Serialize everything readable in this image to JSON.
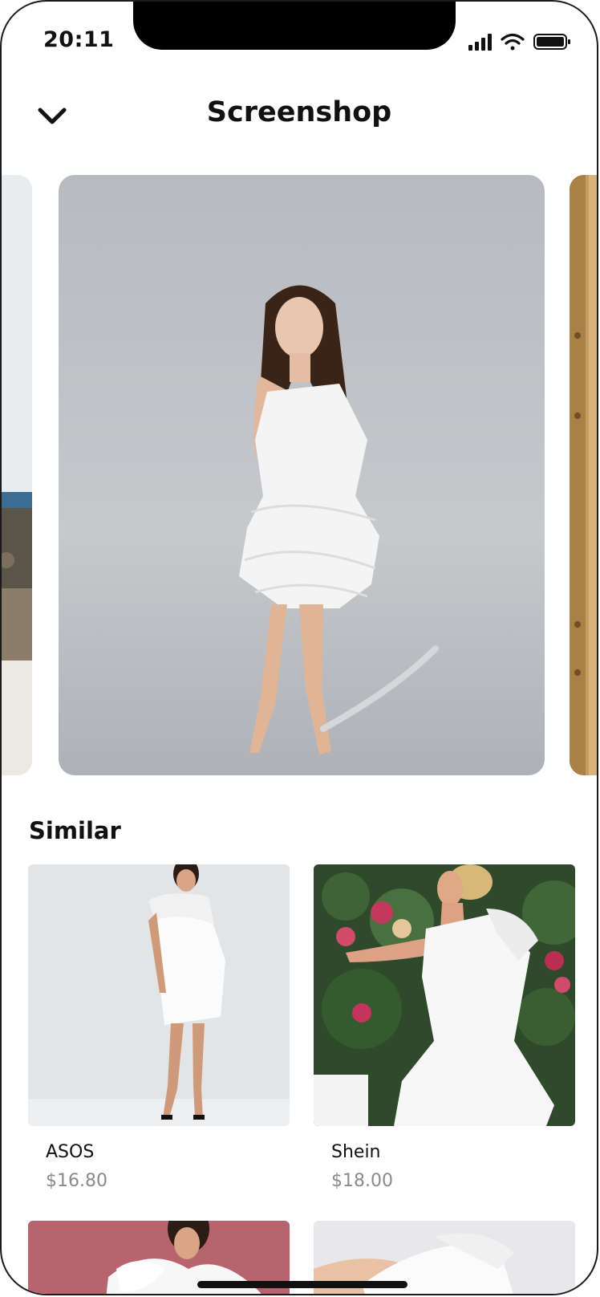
{
  "status_bar": {
    "time": "20:11"
  },
  "header": {
    "title": "Screenshop"
  },
  "carousel": {
    "images": [
      "white-ruffle-dress-model",
      "outdoor-cliff-photo",
      "golden-door-photo"
    ]
  },
  "similar": {
    "title": "Similar",
    "products": [
      {
        "brand": "ASOS",
        "price": "$16.80"
      },
      {
        "brand": "Shein",
        "price": "$18.00"
      }
    ]
  },
  "colors": {
    "text": "#111111",
    "price": "#8a8a8a",
    "photo_bg": "#c7c9cd",
    "card_bg": "#e5e5e7",
    "rose": "#b8646f"
  }
}
